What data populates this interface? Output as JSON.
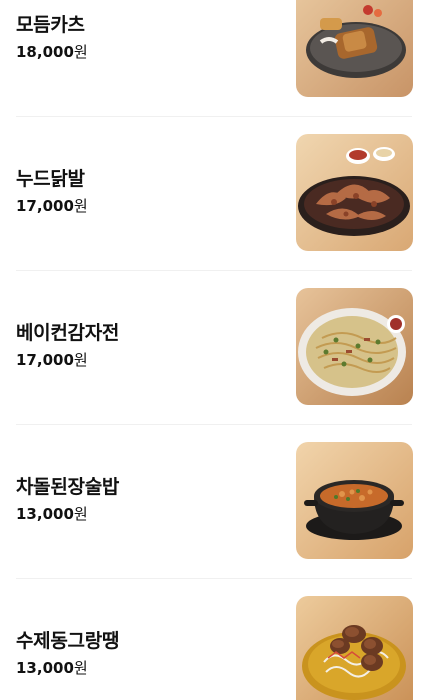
{
  "currency_unit": "원",
  "menu": [
    {
      "name": "모듬카츠",
      "price": "18,000",
      "image_icon": "fried-cutlet-platter-photo"
    },
    {
      "name": "누드닭발",
      "price": "17,000",
      "image_icon": "chicken-feet-hot-plate-photo"
    },
    {
      "name": "베이컨감자전",
      "price": "17,000",
      "image_icon": "bacon-potato-pancake-photo"
    },
    {
      "name": "차돌된장술밥",
      "price": "13,000",
      "image_icon": "beef-soybean-stew-photo"
    },
    {
      "name": "수제동그랑땡",
      "price": "13,000",
      "image_icon": "meat-patties-photo"
    }
  ]
}
